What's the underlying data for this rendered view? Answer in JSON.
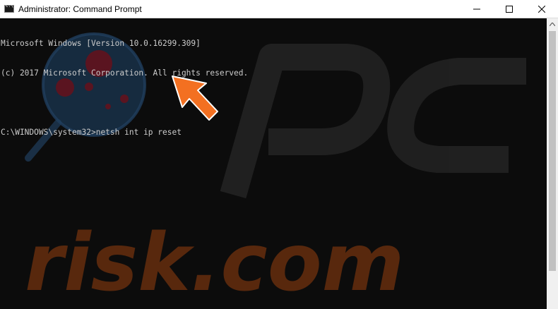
{
  "window": {
    "title": "Administrator: Command Prompt",
    "controls": [
      "minimize",
      "maximize",
      "close"
    ]
  },
  "console": {
    "lines": [
      "Microsoft Windows [Version 10.0.16299.309]",
      "(c) 2017 Microsoft Corporation. All rights reserved.",
      "",
      "C:\\WINDOWS\\system32>netsh int ip reset"
    ]
  },
  "watermark": {
    "text": "risk.com"
  },
  "colors": {
    "console_bg": "#0c0c0c",
    "console_text": "#cccccc",
    "arrow": "#f37021",
    "watermark_orange": "#8a3d12",
    "watermark_gray": "#262626"
  },
  "icons": {
    "app": "cmd-icon",
    "minimize": "minimize-icon",
    "maximize": "maximize-icon",
    "close": "close-icon",
    "scroll_up": "chevron-up-icon",
    "pointer": "arrow-icon"
  }
}
